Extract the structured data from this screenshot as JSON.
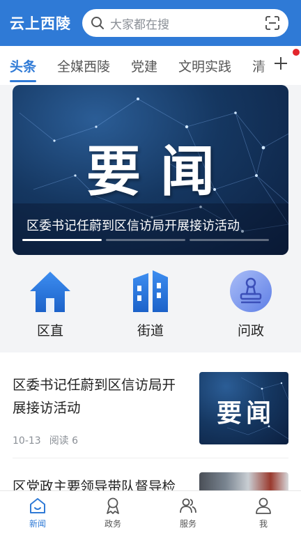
{
  "header": {
    "app_title": "云上西陵",
    "search_placeholder": "大家都在搜"
  },
  "tabs": [
    {
      "label": "头条",
      "active": true
    },
    {
      "label": "全媒西陵",
      "active": false
    },
    {
      "label": "党建",
      "active": false
    },
    {
      "label": "文明实践",
      "active": false
    },
    {
      "label": "清",
      "active": false
    }
  ],
  "banner": {
    "headline": "要闻",
    "caption": "区委书记任蔚到区信访局开展接访活动",
    "slide_count": 3,
    "active_slide": 1
  },
  "quick_entries": [
    {
      "label": "区直",
      "icon": "house-icon"
    },
    {
      "label": "街道",
      "icon": "buildings-icon"
    },
    {
      "label": "问政",
      "icon": "stamp-icon"
    }
  ],
  "news": [
    {
      "title": "区委书记任蔚到区信访局开展接访活动",
      "date": "10-13",
      "reads": "阅读 6",
      "thumb_text": "要闻"
    },
    {
      "title": "区党政主要领导带队督导检"
    }
  ],
  "bottom_nav": [
    {
      "label": "新闻",
      "icon": "news-icon",
      "active": true
    },
    {
      "label": "政务",
      "icon": "ribbon-icon",
      "active": false
    },
    {
      "label": "服务",
      "icon": "people-icon",
      "active": false
    },
    {
      "label": "我",
      "icon": "user-icon",
      "active": false
    }
  ],
  "colors": {
    "primary": "#2f7ad6",
    "notification": "#e3262c"
  }
}
